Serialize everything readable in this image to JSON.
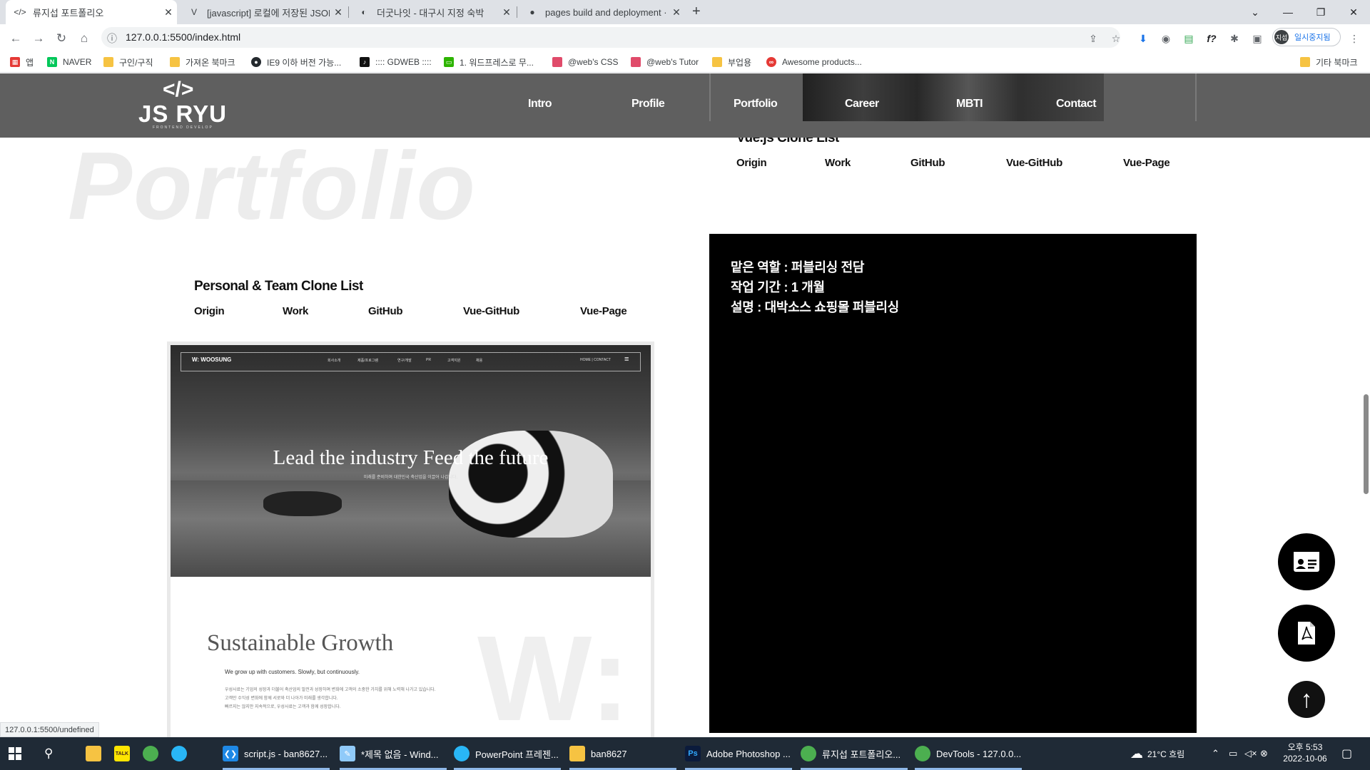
{
  "browser": {
    "tabs": [
      {
        "title": "류지섭 포트폴리오",
        "active": true
      },
      {
        "title": "[javascript] 로컬에 저장된 JSON",
        "active": false
      },
      {
        "title": "더굿나잇 - 대구시 지정 숙박",
        "active": false
      },
      {
        "title": "pages build and deployment · c",
        "active": false
      }
    ],
    "new_tab": "+",
    "url": "127.0.0.1:5500/index.html",
    "profile": {
      "avatar": "지섭",
      "label": "일시중지됨"
    },
    "bookmarks": [
      {
        "label": "앱",
        "color": "#e53935"
      },
      {
        "label": "NAVER",
        "color": "#03c75a"
      },
      {
        "label": "구인/구직",
        "color": "#f6c342"
      },
      {
        "label": "가져온 북마크",
        "color": "#f6c342"
      },
      {
        "label": "IE9 이하 버전 가능...",
        "color": "#24292e"
      },
      {
        "label": ":::: GDWEB ::::",
        "color": "#111111"
      },
      {
        "label": "1. 워드프레스로 무...",
        "color": "#2db400"
      },
      {
        "label": "@web's CSS",
        "color": "#e04b6a"
      },
      {
        "label": "@web's Tutor",
        "color": "#e04b6a"
      },
      {
        "label": "부업용",
        "color": "#f6c342"
      },
      {
        "label": "Awesome products...",
        "color": "#e53935"
      }
    ],
    "other_bookmarks": "기타 북마크",
    "status_url": "127.0.0.1:5500/undefined"
  },
  "site": {
    "logo_mark": "</>",
    "logo_text": "JS RYU",
    "logo_sub": "FRONTEND DEVELOP",
    "nav": [
      "Intro",
      "Profile",
      "Portfolio",
      "Career",
      "MBTI",
      "Contact"
    ],
    "bg_word": "Portfolio",
    "left": {
      "title": "Personal & Team Clone List",
      "links": [
        "Origin",
        "Work",
        "GitHub",
        "Vue-GitHub",
        "Vue-Page"
      ],
      "shot": {
        "logo": "W: WOOSUNG",
        "nav": [
          "회사소개",
          "제품/프로그램",
          "연구/개발",
          "PR",
          "고객지원",
          "채용"
        ],
        "nav_right": "HOME | CONTACT",
        "hero_title": "Lead the industry Feed the future",
        "hero_sub": "미래를 준비하며 대한민국 축산업을 이끌어 나갑니다.",
        "growth_title": "Sustainable Growth",
        "growth_sub": "We grow up with customers. Slowly, but continuously.",
        "growth_lines": [
          "우성사료는 기업의 성장과 더불어 축산업의 발전과 성장하며 변화에 고객의 소중한 가치를 위해 노력해 나가고 있습니다.",
          "고객만 수익성 변화에 함께 서로와 더 나아가 미래를 생각합니다.",
          "빠르지는 않지만 지속적으로, 우성사료는 고객과 함께 성장합니다."
        ],
        "big_letter": "W:"
      }
    },
    "right": {
      "title": "Vue.js Clone List",
      "links": [
        "Origin",
        "Work",
        "GitHub",
        "Vue-GitHub",
        "Vue-Page"
      ],
      "info": [
        "맡은 역할 : 퍼블리싱 전담",
        "작업 기간 : 1 개월",
        "설명 : 대박소스 쇼핑몰 퍼블리싱"
      ]
    },
    "top_button": "↑"
  },
  "taskbar": {
    "apps": [
      {
        "label": "script.js - ban8627...",
        "color": "#1e88e5",
        "icon": "vscode-icon"
      },
      {
        "label": "*제목 없음 - Wind...",
        "color": "#90caf9",
        "icon": "notepad-icon"
      },
      {
        "label": "PowerPoint 프레젠...",
        "color": "#29b6f6",
        "icon": "powerpoint-icon"
      },
      {
        "label": "ban8627",
        "color": "#f6c342",
        "icon": "folder-icon"
      },
      {
        "label": "Adobe Photoshop ...",
        "color": "#0b1b3c",
        "icon": "photoshop-icon"
      },
      {
        "label": "류지섭 포트폴리오...",
        "color": "#4caf50",
        "icon": "chrome-icon"
      },
      {
        "label": "DevTools - 127.0.0...",
        "color": "#4caf50",
        "icon": "chrome-icon"
      }
    ],
    "weather": "21°C 흐림",
    "time": "오후 5:53",
    "date": "2022-10-06"
  }
}
